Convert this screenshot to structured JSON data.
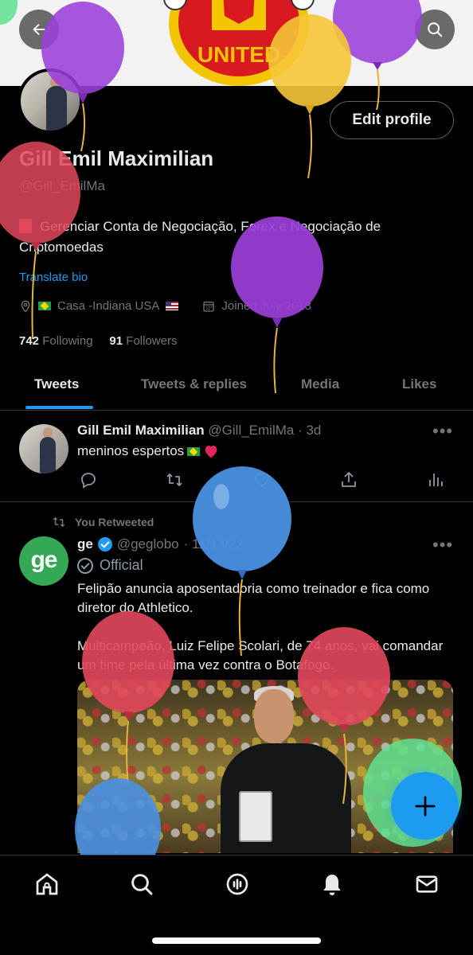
{
  "profile": {
    "name": "Gill Emil Maximilian",
    "handle": "@Gill_EmilMa",
    "bio": "Gerenciar Conta de Negociação, Forex e Negociação de Criptomoedas",
    "translate_label": "Translate bio",
    "location": "Casa -Indiana USA",
    "joined": "Joined July 2013",
    "following_count": "742",
    "following_label": "Following",
    "followers_count": "91",
    "followers_label": "Followers",
    "edit_label": "Edit profile"
  },
  "tabs": [
    {
      "label": "Tweets",
      "active": true
    },
    {
      "label": "Tweets & replies",
      "active": false
    },
    {
      "label": "Media",
      "active": false
    },
    {
      "label": "Likes",
      "active": false
    }
  ],
  "tweets": [
    {
      "author": "Gill Emil Maximilian",
      "handle": "@Gill_EmilMa",
      "time": "· 3d",
      "text": "meninos espertos"
    },
    {
      "retweet_label": "You Retweeted",
      "author": "ge",
      "handle": "@geglobo",
      "time": "· 11/13/22",
      "official_label": "Official",
      "avatar_text": "ge",
      "text1": "Felipão anuncia aposentadoria como treinador e fica como diretor do Athletico.",
      "text2": "Multicampeão, Luiz Felipe Scolari, de 74 anos, vai comandar um time pela última vez contra o Botafogo."
    }
  ],
  "banner": {
    "crest_text": "UNITED"
  },
  "colors": {
    "accent": "#1d9bf0",
    "background": "#000000",
    "text_primary": "#e7e9ea",
    "text_secondary": "#71767b"
  },
  "icons": {
    "top": [
      "back-arrow-icon",
      "search-icon"
    ],
    "tweet_actions": [
      "reply-icon",
      "retweet-icon",
      "like-icon",
      "share-icon",
      "analytics-icon"
    ],
    "bottom_nav": [
      "home-icon",
      "search-icon",
      "spaces-icon",
      "notifications-icon",
      "messages-icon"
    ],
    "fab": "compose-plus-icon"
  }
}
